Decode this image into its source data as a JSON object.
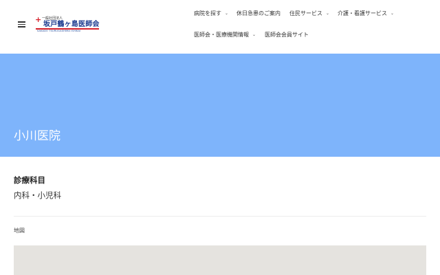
{
  "header": {
    "logo": {
      "corp_label": "一般社団法人",
      "name": "坂戸鶴ヶ島医師会",
      "romanized": "SAKADO TSURUGASHIMA ISHIKAI"
    },
    "nav": [
      {
        "label": "病院を探す",
        "has_dropdown": true
      },
      {
        "label": "休日急患のご案内",
        "has_dropdown": false
      },
      {
        "label": "住民サービス",
        "has_dropdown": true
      },
      {
        "label": "介護・看護サービス",
        "has_dropdown": true
      },
      {
        "label": "医師会・医療機関情報",
        "has_dropdown": true
      },
      {
        "label": "医師会会員サイト",
        "has_dropdown": false
      }
    ],
    "chevron": "⌄"
  },
  "hero": {
    "title": "小川医院",
    "background_color": "#7eb4fb"
  },
  "content": {
    "department_heading": "診療科目",
    "department_value": "内科・小児科",
    "map_label": "地図"
  }
}
